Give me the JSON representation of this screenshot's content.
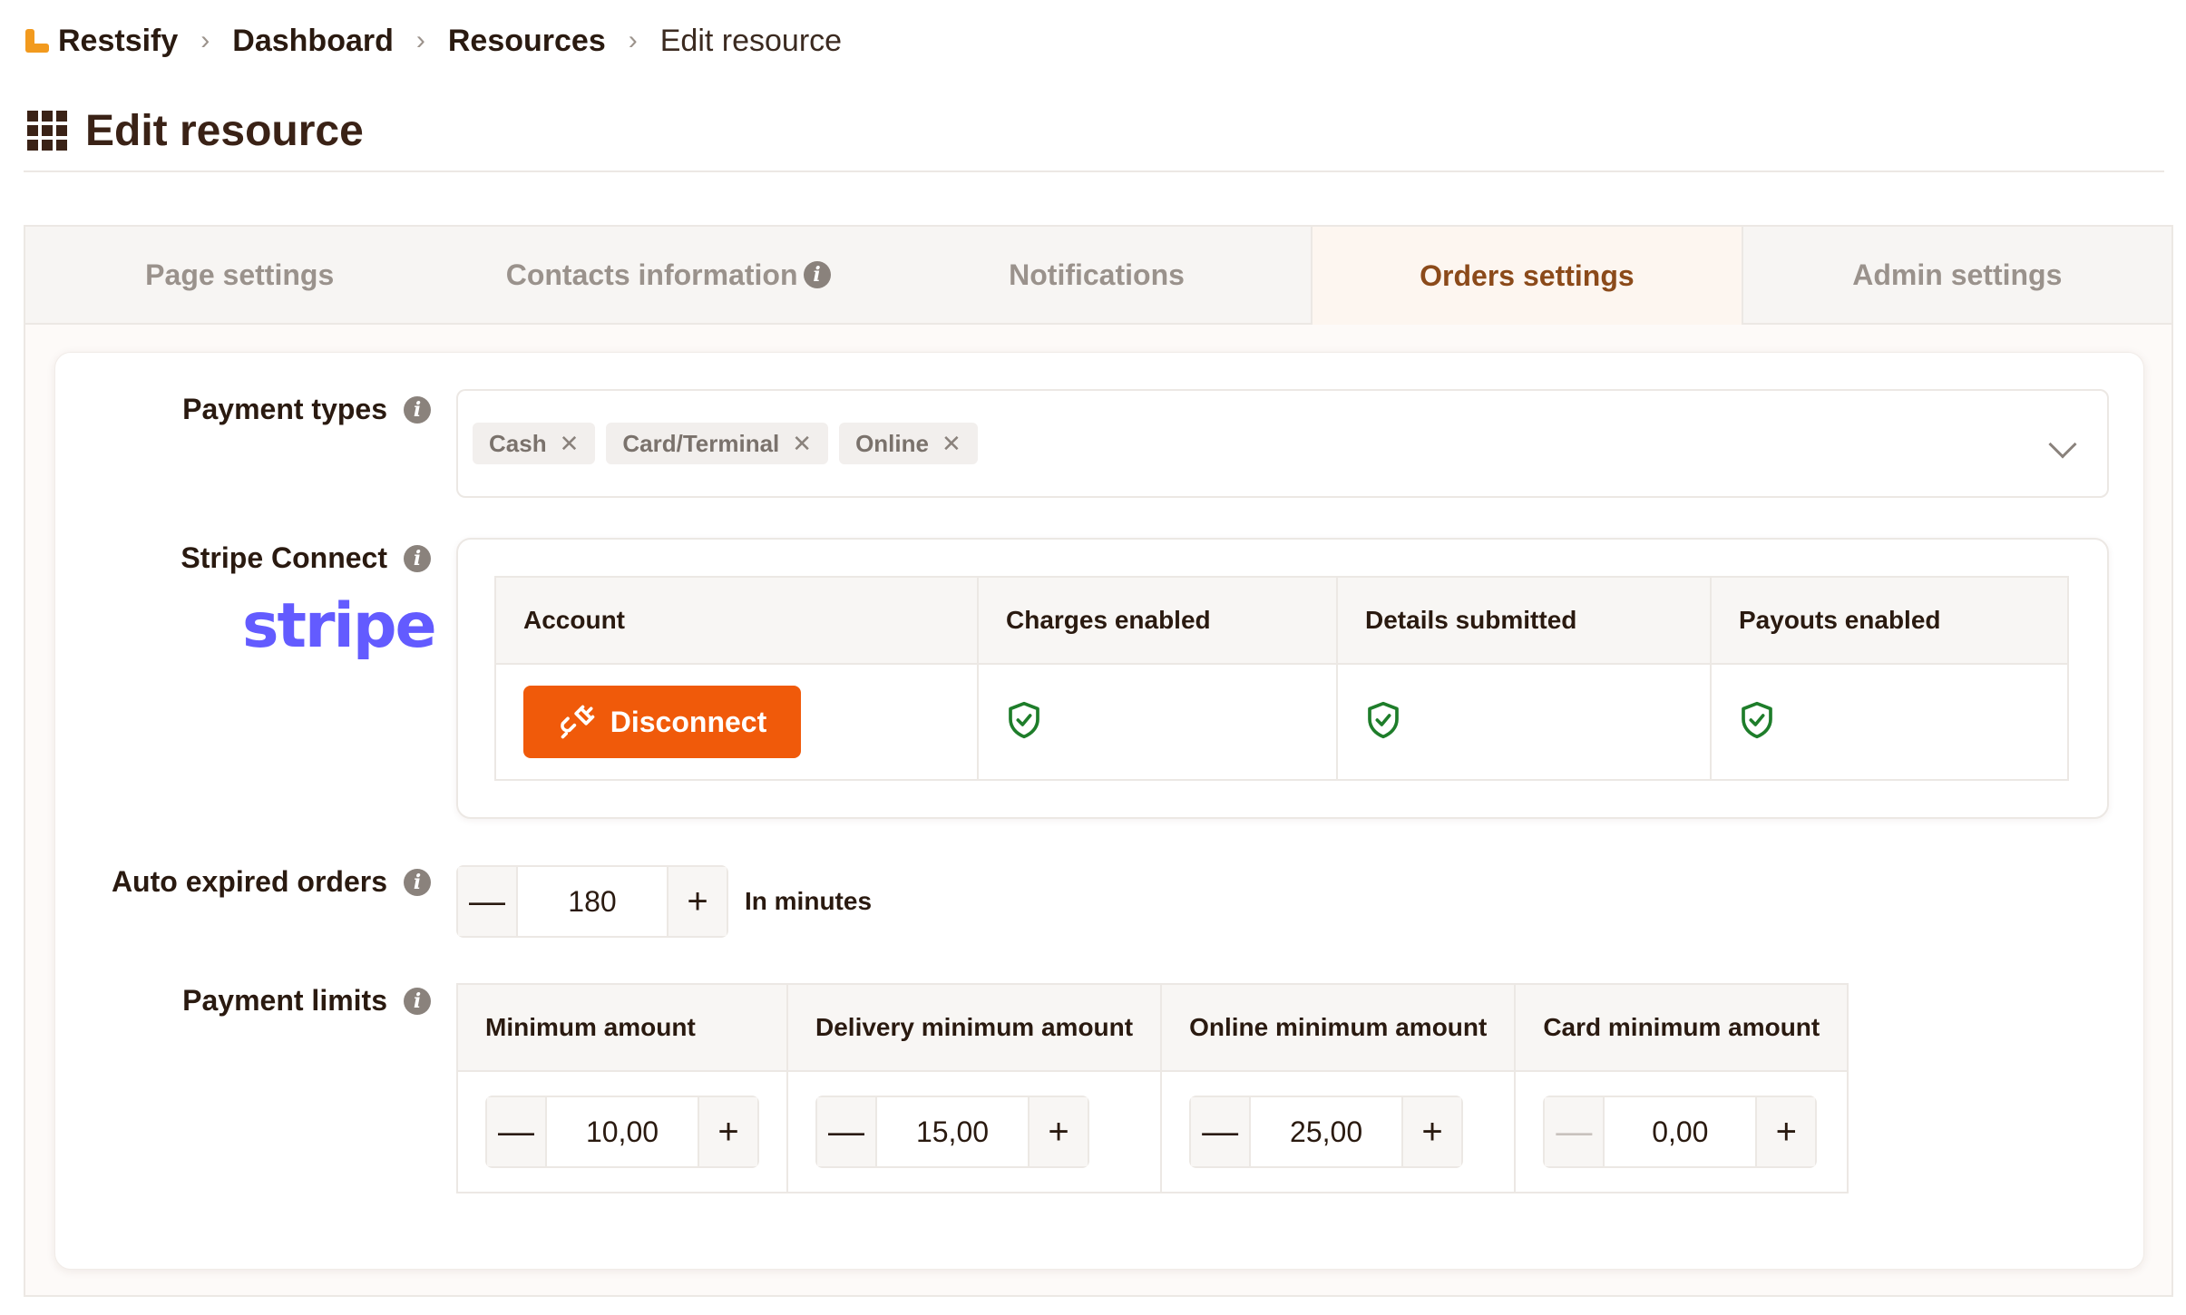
{
  "breadcrumb": {
    "app": "Restsify",
    "items": [
      "Dashboard",
      "Resources"
    ],
    "current": "Edit resource"
  },
  "page": {
    "title": "Edit resource"
  },
  "tabs": [
    {
      "label": "Page settings",
      "info": false
    },
    {
      "label": "Contacts information",
      "info": true
    },
    {
      "label": "Notifications",
      "info": false
    },
    {
      "label": "Orders settings",
      "info": false,
      "active": true
    },
    {
      "label": "Admin settings",
      "info": false
    }
  ],
  "payment_types": {
    "label": "Payment types",
    "selected": [
      "Cash",
      "Card/Terminal",
      "Online"
    ]
  },
  "stripe": {
    "label": "Stripe Connect",
    "logo_text": "stripe",
    "columns": [
      "Account",
      "Charges enabled",
      "Details submitted",
      "Payouts enabled"
    ],
    "disconnect_label": "Disconnect",
    "charges_enabled": true,
    "details_submitted": true,
    "payouts_enabled": true
  },
  "auto_expired": {
    "label": "Auto expired orders",
    "value": "180",
    "unit": "In minutes"
  },
  "payment_limits": {
    "label": "Payment limits",
    "columns": [
      "Minimum amount",
      "Delivery minimum amount",
      "Online minimum amount",
      "Card minimum amount"
    ],
    "values": [
      "10,00",
      "15,00",
      "25,00",
      "0,00"
    ]
  },
  "colors": {
    "accent": "#f05a0a",
    "active_tab_text": "#8b4a1a",
    "stripe_brand": "#635bff",
    "success": "#1e7d2a"
  }
}
